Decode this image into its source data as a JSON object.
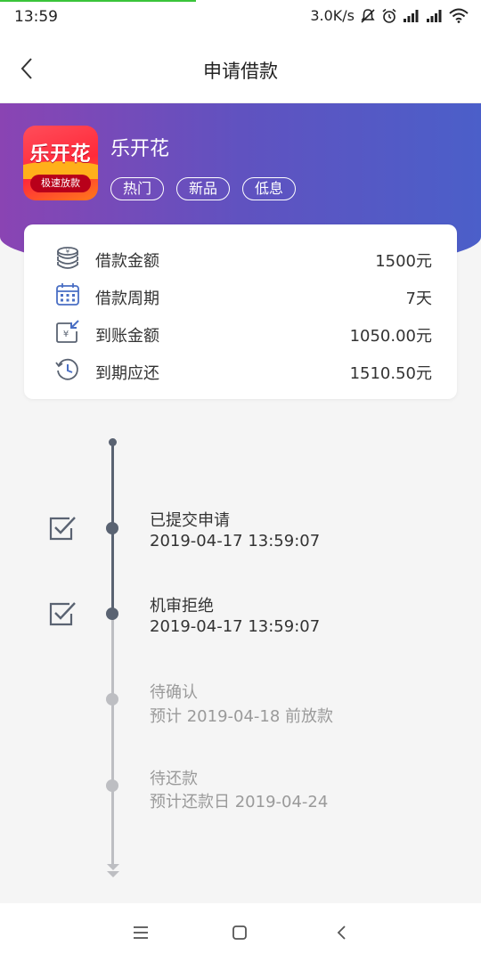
{
  "status": {
    "time": "13:59",
    "net_speed": "3.0K/s",
    "icons": [
      "mute-icon",
      "alarm-icon",
      "signal-icon",
      "signal-icon",
      "wifi-icon"
    ]
  },
  "header": {
    "title": "申请借款"
  },
  "product": {
    "logo_text": "乐开花",
    "logo_ribbon": "极速放款",
    "name": "乐开花",
    "tags": [
      "热门",
      "新品",
      "低息"
    ]
  },
  "loan_info": [
    {
      "icon": "coins-icon",
      "label": "借款金额",
      "value": "1500元"
    },
    {
      "icon": "calendar-icon",
      "label": "借款周期",
      "value": "7天"
    },
    {
      "icon": "received-amount-icon",
      "label": "到账金额",
      "value": "1050.00元"
    },
    {
      "icon": "clock-icon",
      "label": "到期应还",
      "value": "1510.50元"
    }
  ],
  "steps": [
    {
      "title": "已提交申请",
      "subtitle": "2019-04-17 13:59:07",
      "done": true
    },
    {
      "title": "机审拒绝",
      "subtitle": "2019-04-17 13:59:07",
      "done": true
    },
    {
      "title": "待确认",
      "subtitle": "预计 2019-04-18 前放款",
      "done": false
    },
    {
      "title": "待还款",
      "subtitle": "预计还款日 2019-04-24",
      "done": false
    }
  ],
  "colors": {
    "accent_start": "#8a44b3",
    "accent_end": "#4b5fc9",
    "timeline_done": "#5a6372",
    "timeline_pending": "#bdbec2"
  }
}
